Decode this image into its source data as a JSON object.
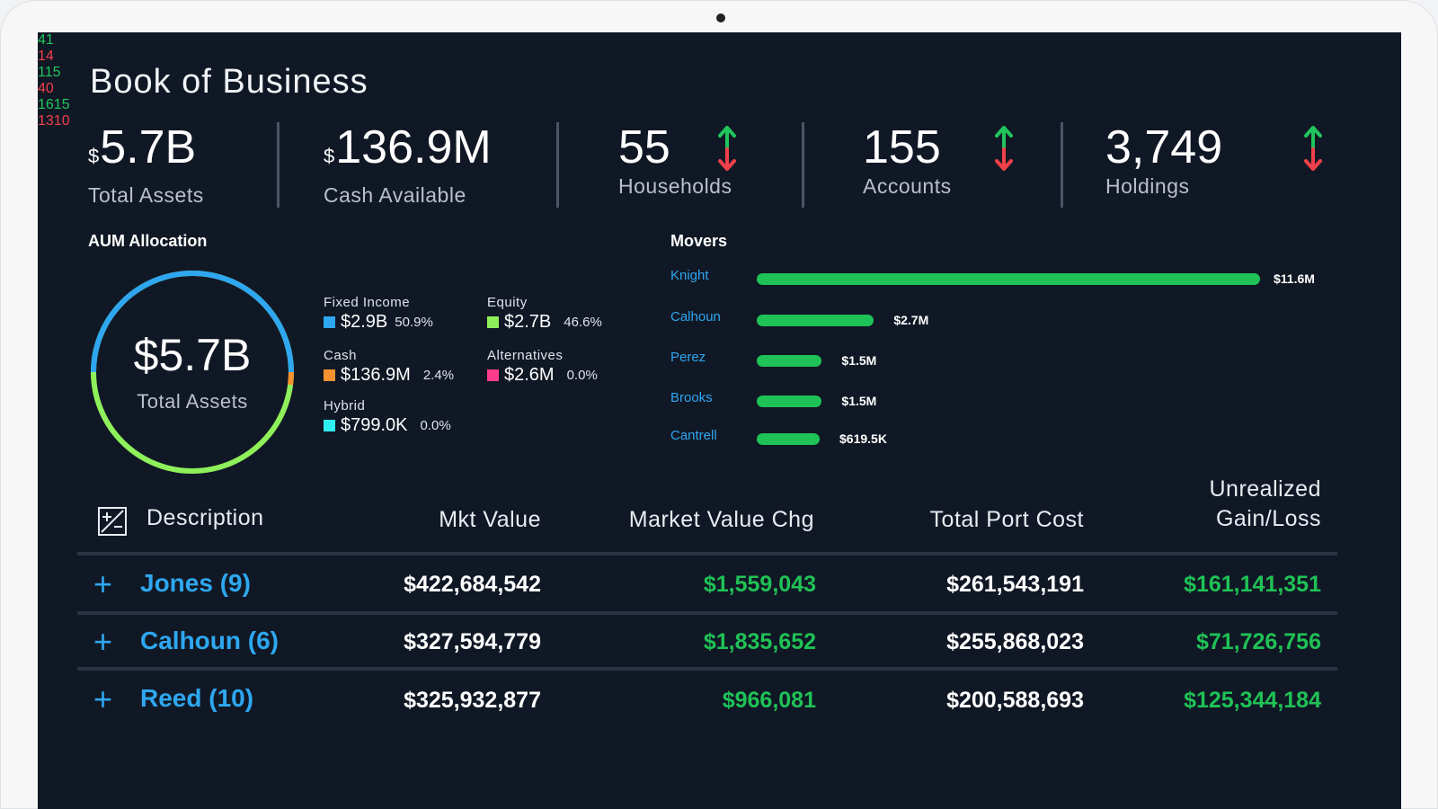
{
  "page": {
    "title": "Book of Business"
  },
  "kpis": {
    "total_assets": {
      "currency": "$",
      "value": "5.7B",
      "label": "Total Assets"
    },
    "cash_available": {
      "currency": "$",
      "value": "136.9M",
      "label": "Cash Available"
    },
    "households": {
      "value": "55",
      "up": "41",
      "down": "14",
      "label": "Households"
    },
    "accounts": {
      "value": "155",
      "up": "115",
      "down": "40",
      "label": "Accounts"
    },
    "holdings": {
      "value": "3,749",
      "up": "1615",
      "down": "1310",
      "label": "Holdings"
    }
  },
  "aum": {
    "title": "AUM Allocation",
    "center_value": "$5.7B",
    "center_label": "Total Assets",
    "items": [
      {
        "name": "Fixed Income",
        "value": "$2.9B",
        "pct": "50.9%",
        "color": "#2ea7f0"
      },
      {
        "name": "Equity",
        "value": "$2.7B",
        "pct": "46.6%",
        "color": "#8ef05a"
      },
      {
        "name": "Cash",
        "value": "$136.9M",
        "pct": "2.4%",
        "color": "#f5922f"
      },
      {
        "name": "Alternatives",
        "value": "$2.6M",
        "pct": "0.0%",
        "color": "#ff3d8a"
      },
      {
        "name": "Hybrid",
        "value": "$799.0K",
        "pct": "0.0%",
        "color": "#2ff0f0"
      }
    ]
  },
  "movers": {
    "title": "Movers",
    "items": [
      {
        "name": "Knight",
        "value": "$11.6M",
        "amount": 11.6
      },
      {
        "name": "Calhoun",
        "value": "$2.7M",
        "amount": 2.7
      },
      {
        "name": "Perez",
        "value": "$1.5M",
        "amount": 1.5
      },
      {
        "name": "Brooks",
        "value": "$1.5M",
        "amount": 1.5
      },
      {
        "name": "Cantrell",
        "value": "$619.5K",
        "amount": 0.6195
      }
    ]
  },
  "table": {
    "headers": {
      "description": "Description",
      "mkt_value": "Mkt Value",
      "mv_chg": "Market Value Chg",
      "port_cost": "Total Port Cost",
      "ugl_line1": "Unrealized",
      "ugl_line2": "Gain/Loss"
    },
    "rows": [
      {
        "name": "Jones (9)",
        "mkt_value": "$422,684,542",
        "mv_chg": "$1,559,043",
        "port_cost": "$261,543,191",
        "ugl": "$161,141,351"
      },
      {
        "name": "Calhoun (6)",
        "mkt_value": "$327,594,779",
        "mv_chg": "$1,835,652",
        "port_cost": "$255,868,023",
        "ugl": "$71,726,756"
      },
      {
        "name": "Reed (10)",
        "mkt_value": "$325,932,877",
        "mv_chg": "$966,081",
        "port_cost": "$200,588,693",
        "ugl": "$125,344,184"
      }
    ]
  }
}
